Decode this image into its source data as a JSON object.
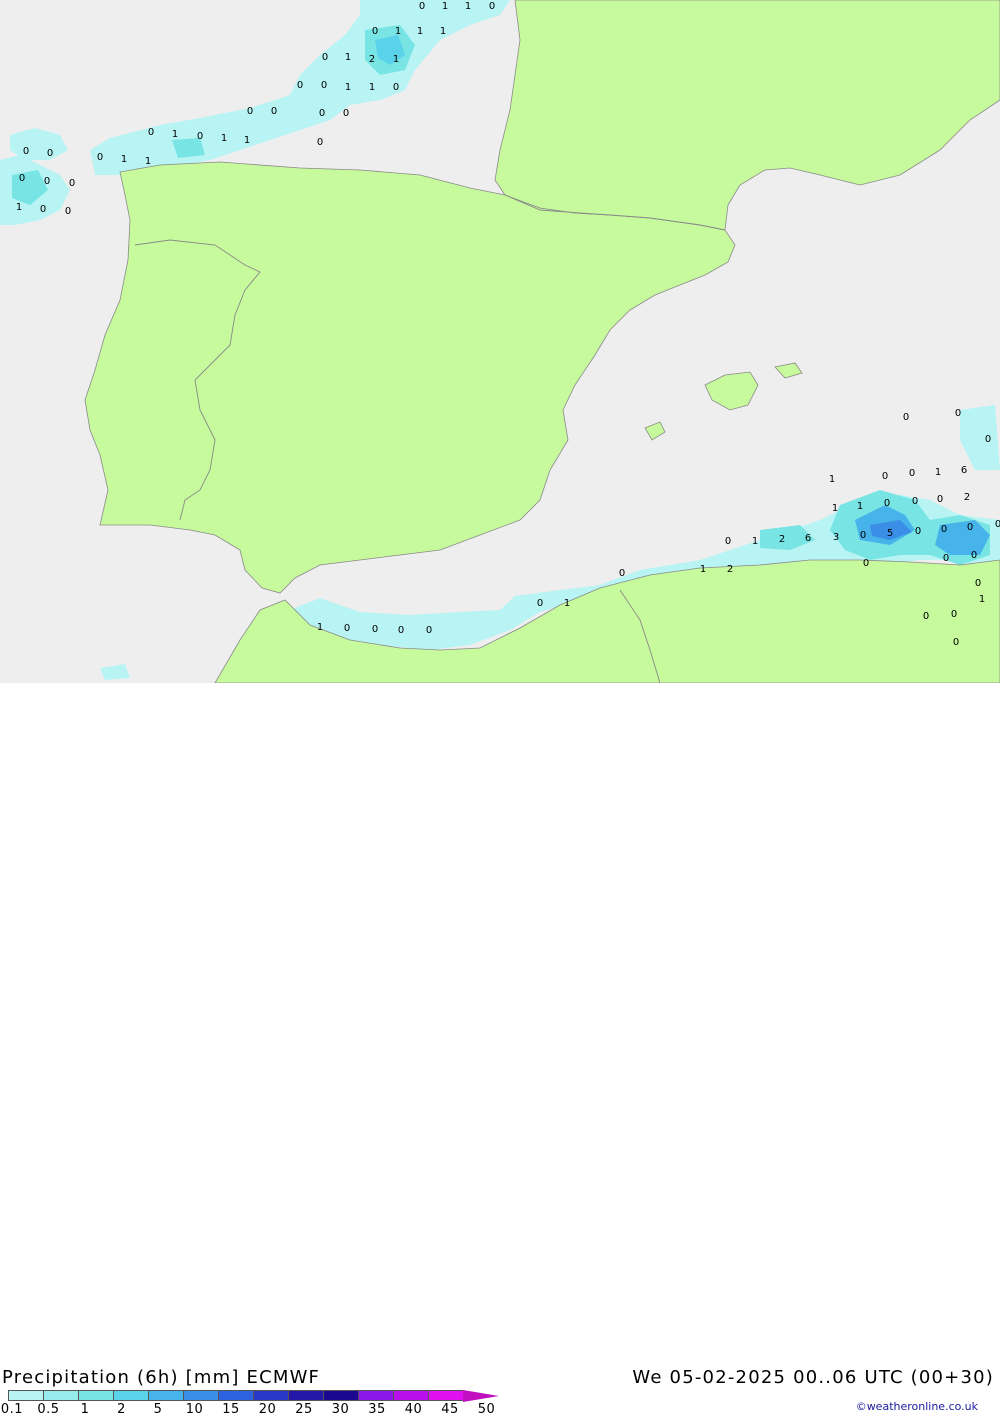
{
  "title_left": "Precipitation (6h) [mm] ECMWF",
  "title_right": "We 05-02-2025 00..06 UTC (00+30)",
  "credit": "©weatheronline.co.uk",
  "colors": {
    "sea": "#eeeeee",
    "land": "#c6fa9c",
    "border": "#8a8a8a"
  },
  "legend": {
    "labels": [
      "0.1",
      "0.5",
      "1",
      "2",
      "5",
      "10",
      "15",
      "20",
      "25",
      "30",
      "35",
      "40",
      "45",
      "50"
    ],
    "colors": [
      "#b8f4f4",
      "#96ecec",
      "#78e4e4",
      "#5ad2ea",
      "#46b4ea",
      "#3a8ee6",
      "#2c62e0",
      "#2a38c8",
      "#2418a8",
      "#1c0890",
      "#8a18e8",
      "#b810ec",
      "#e010f0",
      "#c010c0"
    ]
  },
  "values": [
    {
      "t": "0"
    },
    {
      "t": "1"
    },
    {
      "t": "1"
    },
    {
      "t": "0"
    },
    {
      "t": "0"
    },
    {
      "t": "1"
    },
    {
      "t": "1"
    },
    {
      "t": "1"
    },
    {
      "t": "0"
    },
    {
      "t": "1"
    },
    {
      "t": "2"
    },
    {
      "t": "1"
    },
    {
      "t": "0"
    },
    {
      "t": "0"
    },
    {
      "t": "1"
    },
    {
      "t": "1"
    },
    {
      "t": "0"
    },
    {
      "t": "0"
    },
    {
      "t": "0"
    },
    {
      "t": "0"
    },
    {
      "t": "0"
    },
    {
      "t": "0"
    },
    {
      "t": "0"
    },
    {
      "t": "1"
    },
    {
      "t": "0"
    },
    {
      "t": "1"
    },
    {
      "t": "1"
    },
    {
      "t": "0"
    },
    {
      "t": "0"
    },
    {
      "t": "0"
    },
    {
      "t": "1"
    },
    {
      "t": "1"
    },
    {
      "t": "0"
    },
    {
      "t": "0"
    },
    {
      "t": "0"
    },
    {
      "t": "1"
    },
    {
      "t": "0"
    },
    {
      "t": "0"
    },
    {
      "t": "0"
    },
    {
      "t": "0"
    },
    {
      "t": "0"
    },
    {
      "t": "1"
    },
    {
      "t": "0"
    },
    {
      "t": "0"
    },
    {
      "t": "1"
    },
    {
      "t": "6"
    },
    {
      "t": "1"
    },
    {
      "t": "1"
    },
    {
      "t": "0"
    },
    {
      "t": "0"
    },
    {
      "t": "0"
    },
    {
      "t": "2"
    },
    {
      "t": "0"
    },
    {
      "t": "1"
    },
    {
      "t": "2"
    },
    {
      "t": "6"
    },
    {
      "t": "3"
    },
    {
      "t": "0"
    },
    {
      "t": "5"
    },
    {
      "t": "0"
    },
    {
      "t": "0"
    },
    {
      "t": "0"
    },
    {
      "t": "0"
    },
    {
      "t": "0"
    },
    {
      "t": "1"
    },
    {
      "t": "2"
    },
    {
      "t": "0"
    },
    {
      "t": "0"
    },
    {
      "t": "0"
    },
    {
      "t": "0"
    },
    {
      "t": "1"
    },
    {
      "t": "0"
    },
    {
      "t": "0"
    },
    {
      "t": "0"
    },
    {
      "t": "0"
    },
    {
      "t": "1"
    },
    {
      "t": "1"
    },
    {
      "t": "0"
    },
    {
      "t": "0"
    },
    {
      "t": "0"
    },
    {
      "t": "0"
    }
  ]
}
